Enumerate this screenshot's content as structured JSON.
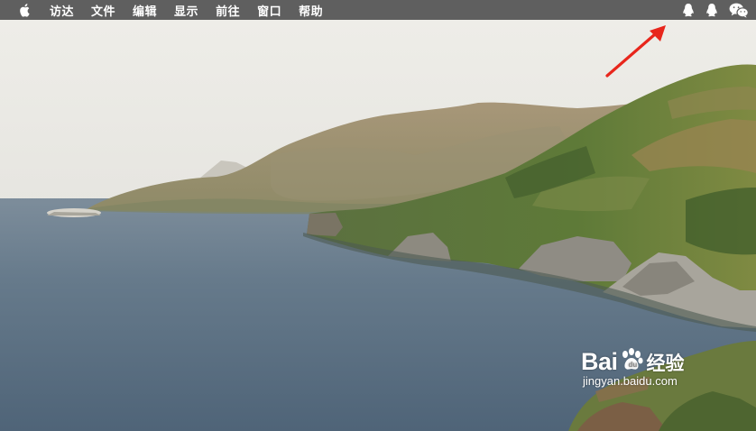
{
  "menubar": {
    "apple_icon": "apple-logo-icon",
    "items": [
      {
        "label": "访达"
      },
      {
        "label": "文件"
      },
      {
        "label": "编辑"
      },
      {
        "label": "显示"
      },
      {
        "label": "前往"
      },
      {
        "label": "窗口"
      },
      {
        "label": "帮助"
      }
    ],
    "status_icons": [
      "qq-penguin-icon",
      "qq-penguin-icon",
      "wechat-icon"
    ],
    "background_color": "#5f5f5f",
    "text_color": "#ffffff"
  },
  "annotation": {
    "arrow_color": "#e8261c",
    "arrow_icon": "red-arrow-icon"
  },
  "watermark": {
    "brand_latin": "Bai",
    "paw_icon": "baidu-paw-icon",
    "brand_cn": "经验",
    "url": "jingyan.baidu.com"
  },
  "wallpaper": {
    "description_icon": "coastal-landscape-wallpaper",
    "sky_color": "#ecebe6",
    "sea_color": "#5f7385"
  }
}
